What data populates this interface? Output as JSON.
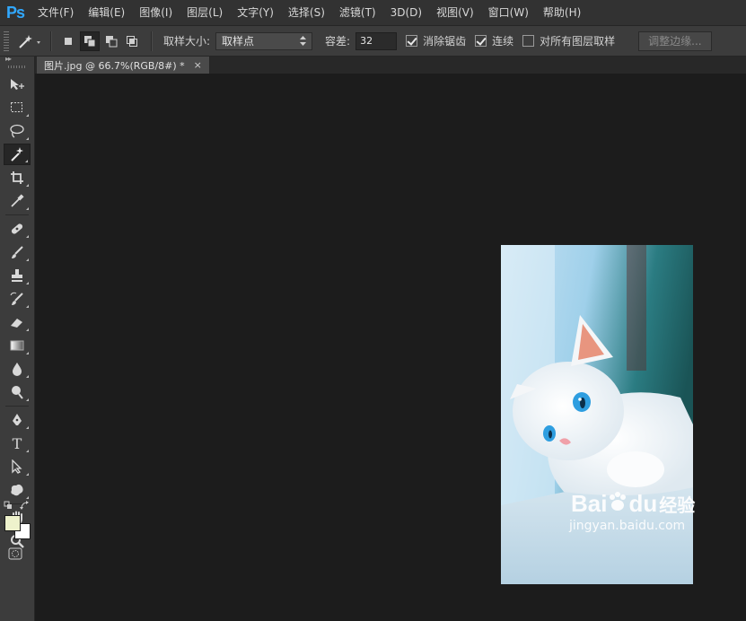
{
  "app": {
    "logo": "Ps"
  },
  "menu": [
    "文件(F)",
    "编辑(E)",
    "图像(I)",
    "图层(L)",
    "文字(Y)",
    "选择(S)",
    "滤镜(T)",
    "3D(D)",
    "视图(V)",
    "窗口(W)",
    "帮助(H)"
  ],
  "options": {
    "tool_icon": "magic-wand-icon",
    "sample_size_label": "取样大小:",
    "sample_size_value": "取样点",
    "tolerance_label": "容差:",
    "tolerance_value": "32",
    "antialias_label": "消除锯齿",
    "antialias_checked": true,
    "contiguous_label": "连续",
    "contiguous_checked": true,
    "sample_all_layers_label": "对所有图层取样",
    "sample_all_layers_checked": false,
    "refine_edge_label": "调整边缘..."
  },
  "toolbar": {
    "tools": [
      "move",
      "marquee",
      "lasso",
      "magic-wand",
      "crop",
      "eyedropper",
      "healing-brush",
      "brush",
      "clone-stamp",
      "history-brush",
      "eraser",
      "gradient",
      "blur",
      "dodge",
      "pen",
      "type",
      "path-selection",
      "shape",
      "hand",
      "zoom"
    ],
    "active": "magic-wand",
    "type_glyph": "T"
  },
  "colors": {
    "foreground": "#eef2cc",
    "background": "#ffffff",
    "accent": "#31a8ff"
  },
  "document": {
    "tab_title": "图片.jpg @ 66.7%(RGB/8#) *",
    "close": "×"
  },
  "watermark": {
    "brand": "Bai",
    "brand2": "du",
    "label": "经验",
    "url": "jingyan.baidu.com"
  }
}
